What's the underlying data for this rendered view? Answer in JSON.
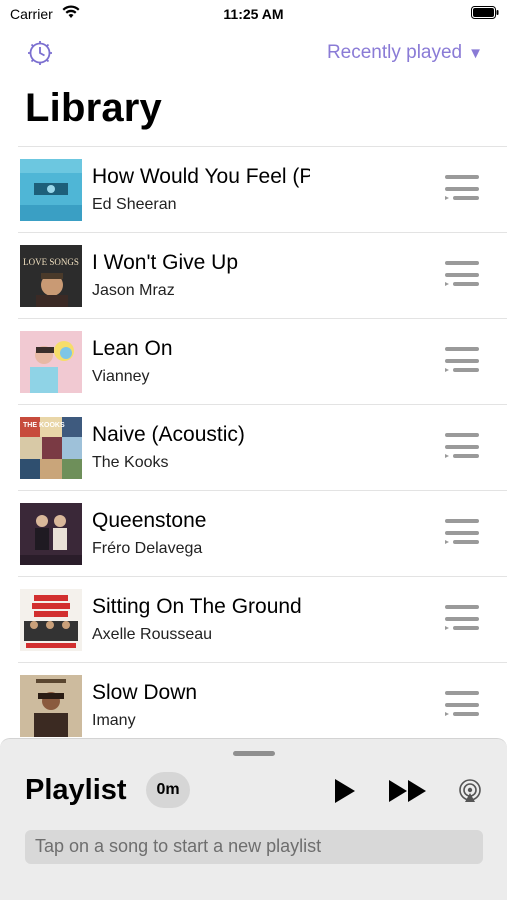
{
  "status_bar": {
    "carrier": "Carrier",
    "time": "11:25 AM"
  },
  "header": {
    "sort_label": "Recently played",
    "sort_caret": "▼",
    "title": "Library"
  },
  "songs": [
    {
      "title": "How Would You Feel (Paean)",
      "artist": "Ed Sheeran"
    },
    {
      "title": "I Won't Give Up",
      "artist": "Jason Mraz"
    },
    {
      "title": "Lean On",
      "artist": "Vianney"
    },
    {
      "title": "Naive (Acoustic)",
      "artist": "The Kooks"
    },
    {
      "title": "Queenstone",
      "artist": "Fréro Delavega"
    },
    {
      "title": "Sitting On The Ground",
      "artist": "Axelle Rousseau"
    },
    {
      "title": "Slow Down",
      "artist": "Imany"
    }
  ],
  "album_art_text": {
    "love_songs": "LOVE SONGS",
    "kooks": "THE KOOKS"
  },
  "playlist": {
    "title": "Playlist",
    "duration": "0m",
    "hint": "Tap on a song to start a new playlist"
  },
  "colors": {
    "accent": "#8a7bd6",
    "handle": "#9a9a9a",
    "sheet": "#ececec"
  }
}
